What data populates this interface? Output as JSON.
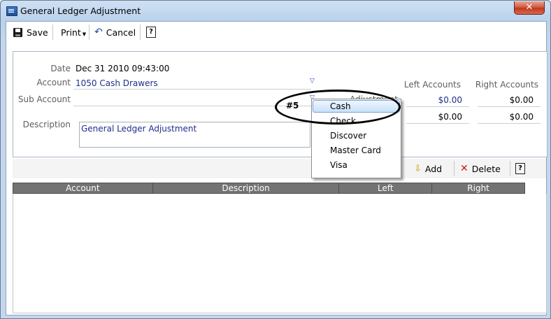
{
  "window": {
    "title": "General Ledger Adjustment",
    "close_glyph": "✕"
  },
  "toolbar": {
    "save": "Save",
    "print": "Print",
    "cancel": "Cancel",
    "help": "?"
  },
  "form": {
    "date_label": "Date",
    "date_value": "Dec 31 2010 09:43:00",
    "account_label": "Account",
    "account_value": "1050 Cash Drawers",
    "subaccount_label": "Sub Account",
    "description_label": "Description",
    "description_value": "General Ledger Adjustment",
    "left_accounts_label": "Left Accounts",
    "right_accounts_label": "Right Accounts",
    "adjustment_label": "Adjustment",
    "row1_left": "$0.00",
    "row1_right": "$0.00",
    "row2_left": "$0.00",
    "row2_right": "$0.00"
  },
  "grid_toolbar": {
    "add": "Add",
    "delete": "Delete",
    "help": "?"
  },
  "grid": {
    "columns": [
      "Account",
      "Description",
      "Left",
      "Right"
    ]
  },
  "dropdown": {
    "options": [
      "Cash",
      "Check",
      "Discover",
      "Master Card",
      "Visa"
    ],
    "selected": "Cash"
  },
  "annotation": {
    "marker": "#5"
  },
  "colors": {
    "accent": "#1f2e8c",
    "header": "#737373"
  }
}
